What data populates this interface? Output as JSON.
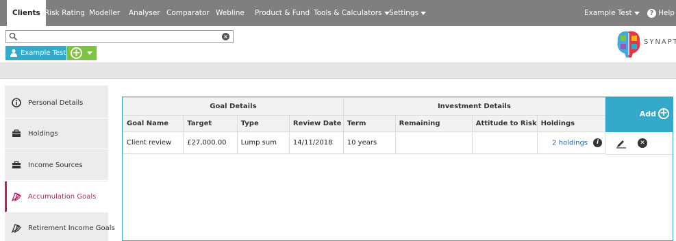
{
  "nav": {
    "tabs": [
      {
        "label": "Clients"
      },
      {
        "label": "Risk Rating"
      },
      {
        "label": "Modeller"
      },
      {
        "label": "Analyser"
      },
      {
        "label": "Comparator"
      },
      {
        "label": "Webline"
      },
      {
        "label": "Product & Fund"
      },
      {
        "label": "Tools & Calculators"
      },
      {
        "label": "Settings"
      }
    ],
    "user": "Example Test",
    "help": "Help"
  },
  "search": {
    "value": "",
    "placeholder": ""
  },
  "client": {
    "name": "Example Test"
  },
  "logo": {
    "text": "SYNAPTI"
  },
  "sidebar": {
    "items": [
      {
        "label": "Personal Details",
        "icon": "info-icon"
      },
      {
        "label": "Holdings",
        "icon": "briefcase-icon"
      },
      {
        "label": "Income Sources",
        "icon": "briefcase-icon"
      },
      {
        "label": "Accumulation Goals",
        "icon": "flags-icon",
        "active": true
      },
      {
        "label": "Retirement Income Goals",
        "icon": "flags-icon"
      }
    ]
  },
  "table": {
    "groups": {
      "goal": "Goal Details",
      "investment": "Investment Details"
    },
    "columns": [
      "Goal Name",
      "Target",
      "Type",
      "Review Date",
      "Term",
      "Remaining",
      "Attitude to Risk",
      "Holdings"
    ],
    "rows": [
      {
        "goal_name": "Client review",
        "target": "£27,000.00",
        "type": "Lump sum",
        "review_date": "14/11/2018",
        "term": "10 years",
        "remaining": "",
        "attitude": "",
        "holdings": "2 holdings"
      }
    ],
    "add_label": "Add"
  },
  "colors": {
    "accent": "#34a9c9",
    "active": "#c51c64",
    "nav": "#7f7f7f",
    "green": "#7cc243"
  }
}
